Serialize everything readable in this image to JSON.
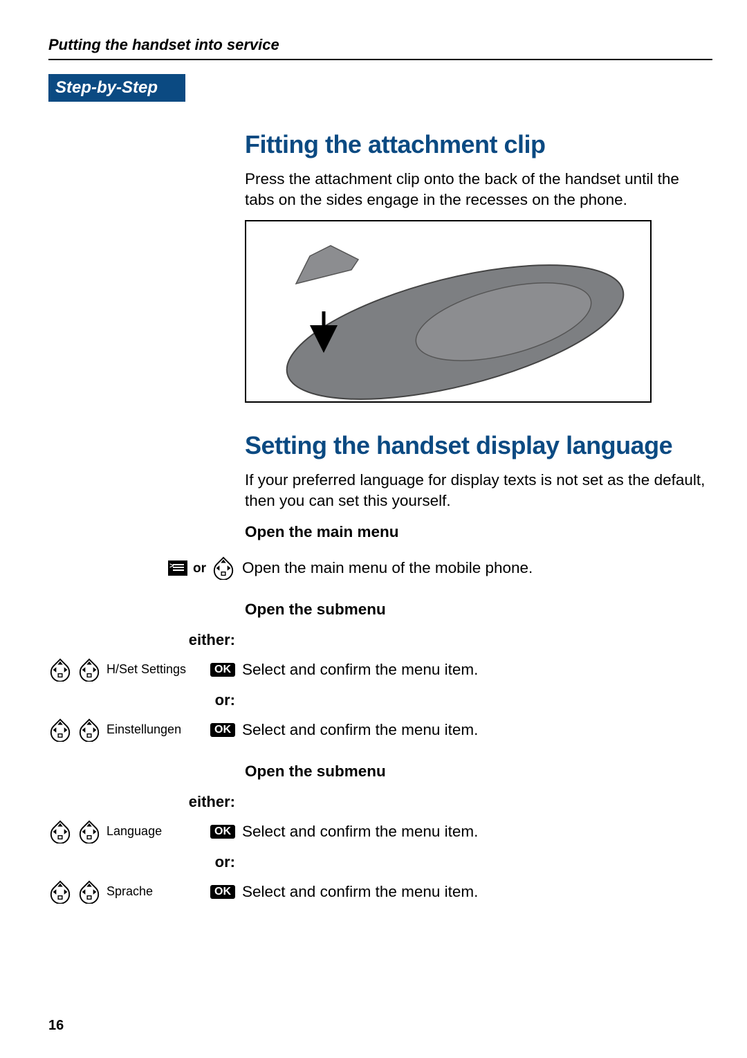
{
  "running_head": "Putting the handset into service",
  "step_tab": "Step-by-Step",
  "section1": {
    "title": "Fitting the attachment clip",
    "para": "Press the attachment clip onto the back of the handset until the tabs on the sides engage in the recesses on the phone."
  },
  "section2": {
    "title": "Setting the handset display language",
    "para": "If your preferred language for display texts is not set as the default, then you can set this yourself.",
    "open_main_h": "Open the main menu",
    "or_word": "or",
    "open_main_text": "Open the main menu of the mobile phone.",
    "open_sub_h1": "Open the submenu",
    "either_label": "either:",
    "or_label": "or:",
    "ok": "OK",
    "rows": [
      {
        "menu": "H/Set Settings",
        "text": "Select and confirm the menu item."
      },
      {
        "menu": "Einstellungen",
        "text": "Select and confirm the menu item."
      }
    ],
    "open_sub_h2": "Open the submenu",
    "rows2": [
      {
        "menu": "Language",
        "text": "Select and confirm the menu item."
      },
      {
        "menu": "Sprache",
        "text": "Select and confirm the menu item."
      }
    ]
  },
  "page_number": "16"
}
